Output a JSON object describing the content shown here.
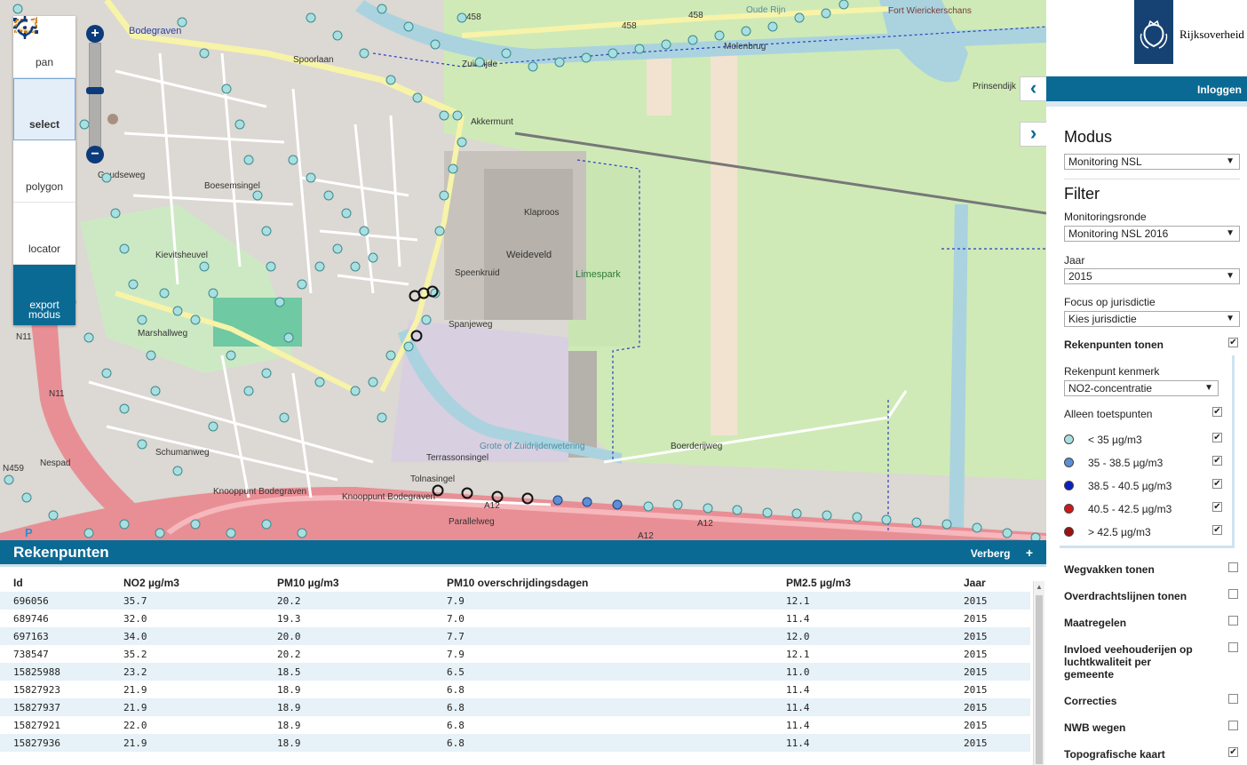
{
  "toolbar": {
    "pan_label": "pan",
    "select_label": "select",
    "polygon_label": "polygon",
    "locator_label": "locator",
    "export_label_1": "export",
    "export_label_2": "modus"
  },
  "zoom": {
    "plus": "+",
    "minus": "−",
    "level_fraction": 0.42
  },
  "map_labels": {
    "bodegraven": "Bodegraven",
    "spoorlaan": "Spoorlaan",
    "weideveld": "Weideveld",
    "limespark": "Limespark",
    "oude_rijn": "Oude Rijn",
    "fort": "Fort Wierickerschans",
    "molenbrug": "Molenbrug",
    "knooppunt1": "Knooppunt Bodegraven",
    "knooppunt2": "Knooppunt Bodegraven",
    "a12_1": "A12",
    "a12_2": "A12",
    "a12_3": "A12",
    "n11_1": "N11",
    "n11_2": "N11",
    "n459": "N459",
    "r458_1": "458",
    "r458_2": "458",
    "r458_3": "458",
    "tolnasingel": "Tolnasingel",
    "parallelweg": "Parallelweg",
    "boerderijweg": "Boerderijweg",
    "goudseweg": "Goudseweg",
    "spanjeweg": "Spanjeweg",
    "zuidzijde": "Zuidzijde",
    "prinsendijk": "Prinsendijk",
    "akkermunt": "Akkermunt",
    "klaproos": "Klaproos",
    "nespad": "Nespad",
    "schumanweg": "Schumanweg",
    "terrassonsingel": "Terrassonsingel",
    "zuidrijderwetering": "Grote of Zuidrijderwetering",
    "marshallweg": "Marshallweg",
    "speenkruid": "Speenkruid",
    "kievitsheuvel": "Kievitsheuvel",
    "boesemsingel": "Boesemsingel"
  },
  "table": {
    "title": "Rekenpunten",
    "hide_label": "Verberg",
    "plus": "+",
    "columns": [
      "Id",
      "NO2 µg/m3",
      "PM10 µg/m3",
      "PM10 overschrijdingsdagen",
      "PM2.5 µg/m3",
      "Jaar"
    ],
    "rows": [
      [
        "696056",
        "35.7",
        "20.2",
        "7.9",
        "12.1",
        "2015"
      ],
      [
        "689746",
        "32.0",
        "19.3",
        "7.0",
        "11.4",
        "2015"
      ],
      [
        "697163",
        "34.0",
        "20.0",
        "7.7",
        "12.0",
        "2015"
      ],
      [
        "738547",
        "35.2",
        "20.2",
        "7.9",
        "12.1",
        "2015"
      ],
      [
        "15825988",
        "23.2",
        "18.5",
        "6.5",
        "11.0",
        "2015"
      ],
      [
        "15827923",
        "21.9",
        "18.9",
        "6.8",
        "11.4",
        "2015"
      ],
      [
        "15827937",
        "21.9",
        "18.9",
        "6.8",
        "11.4",
        "2015"
      ],
      [
        "15827921",
        "22.0",
        "18.9",
        "6.8",
        "11.4",
        "2015"
      ],
      [
        "15827936",
        "21.9",
        "18.9",
        "6.8",
        "11.4",
        "2015"
      ]
    ]
  },
  "sidebar": {
    "logo_text": "Rijksoverheid",
    "login": "Inloggen",
    "modus_title": "Modus",
    "modus_value": "Monitoring NSL",
    "filter_title": "Filter",
    "ronde_label": "Monitoringsronde",
    "ronde_value": "Monitoring NSL 2016",
    "jaar_label": "Jaar",
    "jaar_value": "2015",
    "focus_label": "Focus op jurisdictie",
    "focus_value": "Kies jurisdictie",
    "rekenpunten_label": "Rekenpunten tonen",
    "kenmerk_label": "Rekenpunt kenmerk",
    "kenmerk_value": "NO2-concentratie",
    "toetspunten_label": "Alleen toetspunten",
    "legend": [
      {
        "label": "< 35 µg/m3",
        "color": "#a9dfe0",
        "checked": true
      },
      {
        "label": "35 - 38.5 µg/m3",
        "color": "#5b8fd6",
        "checked": true
      },
      {
        "label": "38.5 - 40.5 µg/m3",
        "color": "#0a1fc0",
        "checked": true
      },
      {
        "label": "40.5 - 42.5 µg/m3",
        "color": "#d01818",
        "checked": true
      },
      {
        "label": "> 42.5 µg/m3",
        "color": "#a01010",
        "checked": true
      }
    ],
    "layers": [
      {
        "label": "Wegvakken tonen",
        "checked": false
      },
      {
        "label": "Overdrachtslijnen tonen",
        "checked": false
      },
      {
        "label": "Maatregelen",
        "checked": false
      },
      {
        "label": "Invloed veehouderijen op luchtkwaliteit per gemeente",
        "checked": false
      },
      {
        "label": "Correcties",
        "checked": false
      },
      {
        "label": "NWB wegen",
        "checked": false
      },
      {
        "label": "Topografische kaart",
        "checked": true
      }
    ],
    "check_mark": "✔"
  },
  "colors": {
    "accent": "#0b6a94",
    "brand": "#154273"
  }
}
